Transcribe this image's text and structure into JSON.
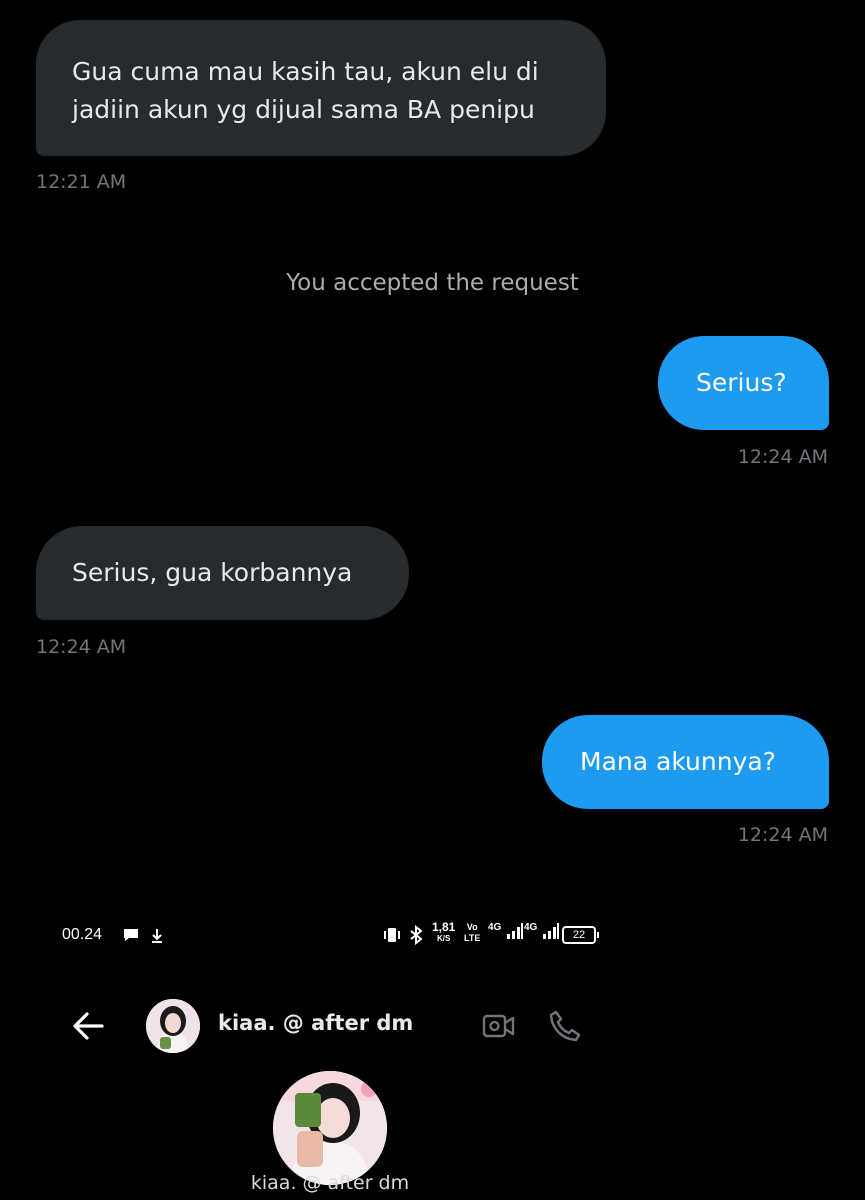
{
  "messages": [
    {
      "id": "b1",
      "direction": "in",
      "text": "Gua cuma mau kasih tau, akun elu di jadiin akun yg dijual sama BA penipu",
      "time": "12:21 AM"
    },
    {
      "id": "b2",
      "direction": "out",
      "text": "Serius?",
      "time": "12:24 AM"
    },
    {
      "id": "b3",
      "direction": "in",
      "text": "Serius, gua korbannya",
      "time": "12:24 AM"
    },
    {
      "id": "b4",
      "direction": "out",
      "text": "Mana akunnya?",
      "time": "12:24 AM"
    }
  ],
  "system_message": "You accepted the request",
  "status_bar": {
    "time": "00.24",
    "net_speed_value": "1,81",
    "net_speed_unit": "K/S",
    "volte_top": "Vo",
    "volte_bottom": "LTE",
    "sim1": "4G",
    "sim2": "4G",
    "battery": "22"
  },
  "header": {
    "name": "kiaa. @ after dm"
  },
  "profile": {
    "name": "kiaa. @ after dm"
  },
  "colors": {
    "background": "#000000",
    "incoming_bubble": "#262b30",
    "outgoing_bubble": "#1d9bf0",
    "timestamp": "#71767b"
  }
}
